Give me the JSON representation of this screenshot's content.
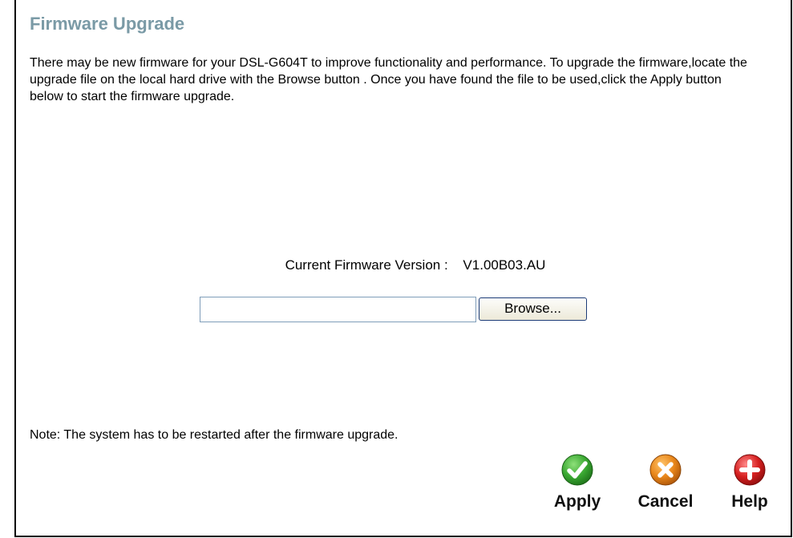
{
  "page": {
    "title": "Firmware Upgrade",
    "intro": "There may be new firmware for your DSL-G604T to improve functionality and performance. To upgrade the firmware,locate the upgrade file on the local hard drive with the Browse button . Once you have found the file to be used,click the Apply button below to start the firmware upgrade.",
    "note": "Note: The system has to be restarted after the firmware upgrade."
  },
  "firmware": {
    "version_label": "Current Firmware Version :",
    "version_value": "V1.00B03.AU",
    "file_value": "",
    "browse_label": "Browse..."
  },
  "actions": {
    "apply": {
      "label": "Apply",
      "icon": "checkmark-icon",
      "color": "#3aa832"
    },
    "cancel": {
      "label": "Cancel",
      "icon": "x-icon",
      "color": "#e8861a"
    },
    "help": {
      "label": "Help",
      "icon": "plus-icon",
      "color": "#d62020"
    }
  },
  "colors": {
    "title": "#7a9aa6",
    "border": "#000000"
  }
}
